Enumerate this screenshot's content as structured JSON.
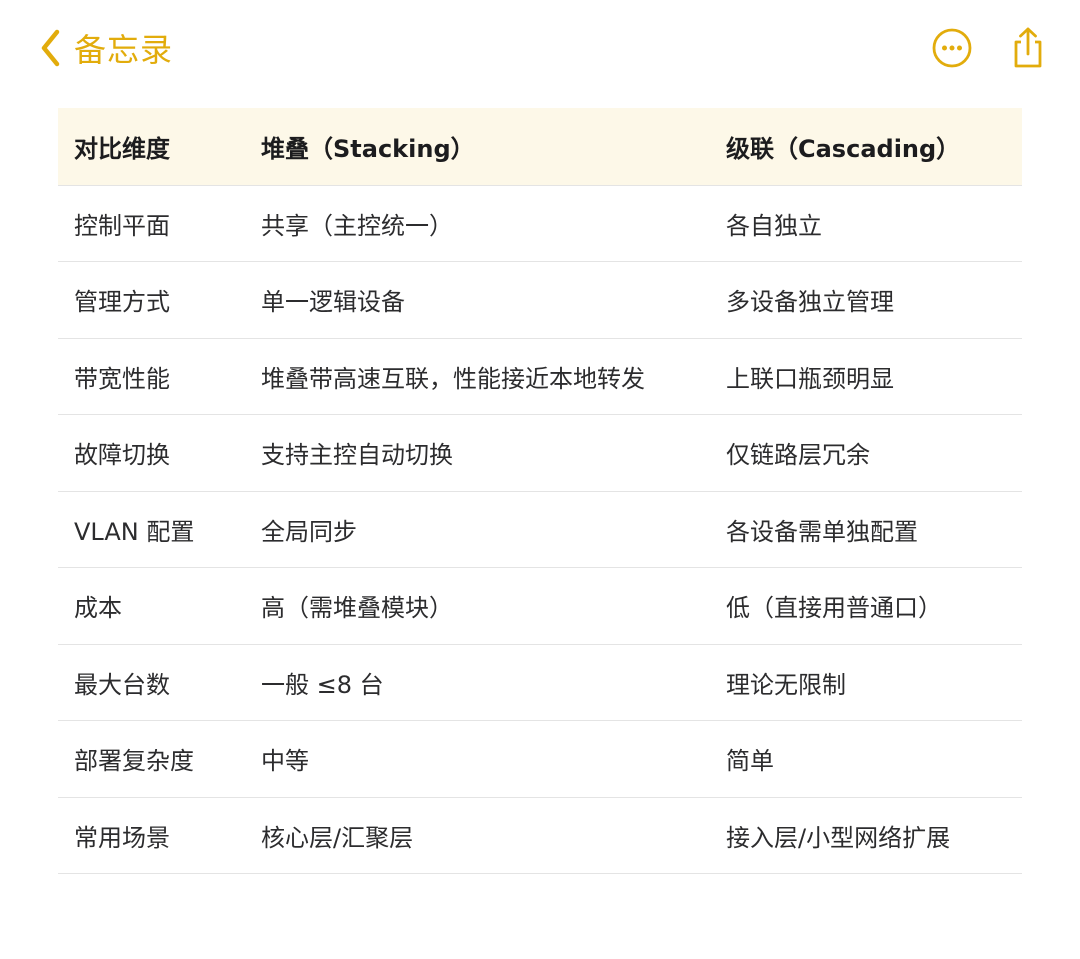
{
  "colors": {
    "accent": "#e2ac0c",
    "header_bg": "#fdf8e8",
    "divider": "#e4e4e4"
  },
  "nav": {
    "back_label": "备忘录",
    "back_icon": "chevron-left-icon",
    "more_icon": "ellipsis-circle-icon",
    "share_icon": "share-icon"
  },
  "table": {
    "headers": [
      "对比维度",
      "堆叠（Stacking）",
      "级联（Cascading）"
    ],
    "rows": [
      [
        "控制平面",
        "共享（主控统一）",
        "各自独立"
      ],
      [
        "管理方式",
        "单一逻辑设备",
        "多设备独立管理"
      ],
      [
        "带宽性能",
        "堆叠带高速互联，性能接近本地转发",
        "上联口瓶颈明显"
      ],
      [
        "故障切换",
        "支持主控自动切换",
        "仅链路层冗余"
      ],
      [
        "VLAN 配置",
        "全局同步",
        "各设备需单独配置"
      ],
      [
        "成本",
        "高（需堆叠模块）",
        "低（直接用普通口）"
      ],
      [
        "最大台数",
        "一般 ≤8 台",
        "理论无限制"
      ],
      [
        "部署复杂度",
        "中等",
        "简单"
      ],
      [
        "常用场景",
        "核心层/汇聚层",
        "接入层/小型网络扩展"
      ]
    ]
  }
}
